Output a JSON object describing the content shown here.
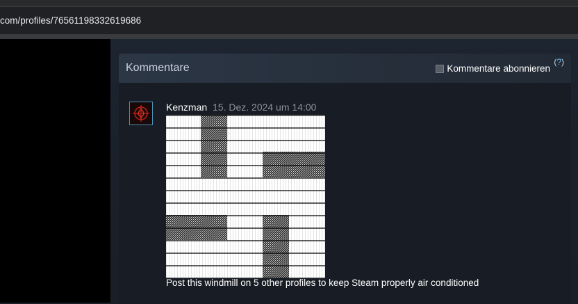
{
  "browser": {
    "url": "com/profiles/76561198332619686"
  },
  "comments_section": {
    "title": "Kommentare",
    "subscribe_label": "Kommentare abonnieren",
    "subscribe_checked": false,
    "help_label": "?"
  },
  "comments": [
    {
      "author": "Kenzman",
      "timestamp": "15. Dez. 2024 um 14:00",
      "text": "Post this windmill on 5 other profiles to keep Steam properly air conditioned"
    }
  ],
  "colors": {
    "accent": "#66c0f4",
    "card_bg": "#181c24",
    "timestamp": "#8b929a"
  },
  "icons": {
    "avatar": "red-crosshair-avatar-icon",
    "checkbox": "checkbox-icon"
  }
}
